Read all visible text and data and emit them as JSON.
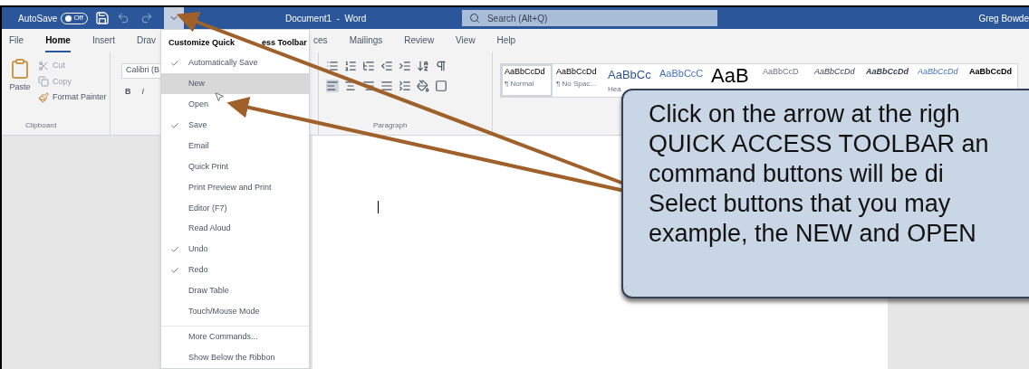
{
  "title_bar": {
    "autosave_label": "AutoSave",
    "autosave": {
      "text": "Off",
      "on": false
    },
    "document_title": "Document1  -  Word",
    "search": {
      "placeholder": "Search (Alt+Q)"
    },
    "user": "Greg Bowde"
  },
  "tabs": [
    {
      "label": "File",
      "selected": false
    },
    {
      "label": "Home",
      "selected": true
    },
    {
      "label": "Insert",
      "selected": false
    },
    {
      "label": "Drav",
      "selected": false
    },
    {
      "label": "ces",
      "selected": false
    },
    {
      "label": "Mailings",
      "selected": false
    },
    {
      "label": "Review",
      "selected": false
    },
    {
      "label": "View",
      "selected": false
    },
    {
      "label": "Help",
      "selected": false
    }
  ],
  "clipboard": {
    "paste": "Paste",
    "cut": "Cut",
    "copy": "Copy",
    "format_painter": "Format Painter",
    "group_label": "Clipboard"
  },
  "font": {
    "font_name": "Calibri (B",
    "bold": "B",
    "italic": "I"
  },
  "paragraph": {
    "group_label": "Paragraph"
  },
  "styles": [
    {
      "sample": "AaBbCcDd",
      "label": "¶ Normal",
      "kind": "normal",
      "selected": true
    },
    {
      "sample": "AaBbCcDd",
      "label": "¶ No Spac...",
      "kind": "normal",
      "selected": false
    },
    {
      "sample": "AaBbCc",
      "label": "Hea",
      "kind": "heading1",
      "selected": false
    },
    {
      "sample": "AaBbCcC",
      "kind": "heading2",
      "selected": false
    },
    {
      "sample": "AaB",
      "kind": "title",
      "selected": false
    },
    {
      "sample": "AaBbCcD",
      "kind": "subtitle",
      "selected": false
    },
    {
      "sample": "AaBbCcDd",
      "kind": "emphasis",
      "selected": false
    },
    {
      "sample": "AaBbCcDd",
      "kind": "strong_emphasis",
      "selected": false
    },
    {
      "sample": "AaBbCcDd",
      "kind": "intense",
      "selected": false
    },
    {
      "sample": "AaBbCcDd",
      "kind": "strong",
      "selected": false
    }
  ],
  "quick_access_menu": {
    "title_parts": [
      "Customize Quick",
      "ess Toolbar"
    ],
    "items": [
      {
        "label": "Automatically Save",
        "checked": true,
        "selected": false
      },
      {
        "label": "New",
        "checked": false,
        "selected": true
      },
      {
        "label": "Open",
        "checked": false,
        "selected": false
      },
      {
        "label": "Save",
        "checked": true,
        "selected": false
      },
      {
        "label": "Email",
        "checked": false,
        "selected": false
      },
      {
        "label": "Quick Print",
        "checked": false,
        "selected": false
      },
      {
        "label": "Print Preview and Print",
        "checked": false,
        "selected": false
      },
      {
        "label": "Editor (F7)",
        "checked": false,
        "selected": false
      },
      {
        "label": "Read Aloud",
        "checked": false,
        "selected": false
      },
      {
        "label": "Undo",
        "checked": true,
        "selected": false
      },
      {
        "label": "Redo",
        "checked": true,
        "selected": false
      },
      {
        "label": "Draw Table",
        "checked": false,
        "selected": false
      },
      {
        "label": "Touch/Mouse Mode",
        "checked": false,
        "selected": false
      }
    ],
    "footer_items": [
      {
        "label": "More Commands..."
      },
      {
        "label": "Show Below the Ribbon"
      }
    ]
  },
  "callout": {
    "lines": [
      "Click on the arrow at the righ",
      "QUICK ACCESS TOOLBAR an",
      "command buttons will be di",
      "Select buttons that you may",
      "example, the NEW and OPEN"
    ]
  }
}
